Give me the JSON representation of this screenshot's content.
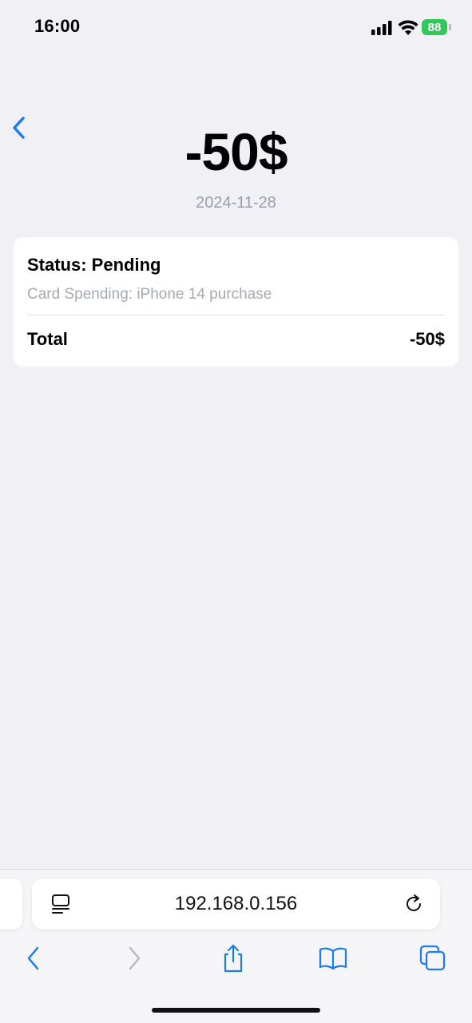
{
  "status_bar": {
    "time": "16:00",
    "battery_level": "88",
    "icons": [
      "signal-icon",
      "wifi-icon",
      "battery-icon"
    ]
  },
  "transaction": {
    "amount": "-50$",
    "date": "2024-11-28",
    "status_text": "Status: Pending",
    "description": "Card Spending: iPhone 14 purchase",
    "total_label": "Total",
    "total_value": "-50$"
  },
  "browser": {
    "url": "192.168.0.156",
    "toolbar_icons": [
      "back-icon",
      "forward-icon",
      "share-icon",
      "bookmarks-icon",
      "tabs-icon"
    ]
  },
  "colors": {
    "accent": "#1a7cf0",
    "background": "#f0f0f5",
    "muted_text": "#9aa0ab",
    "battery": "#32c759"
  }
}
